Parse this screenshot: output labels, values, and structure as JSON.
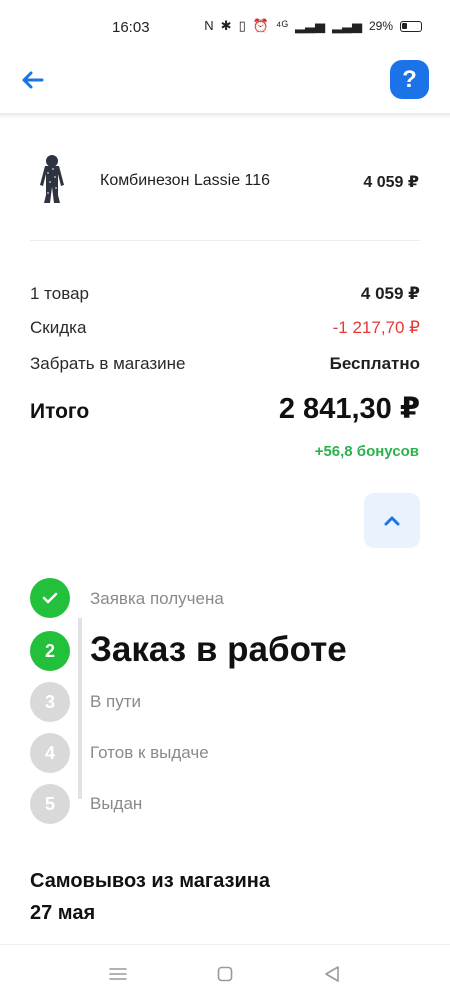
{
  "status_bar": {
    "time": "16:03",
    "network": "⁴ᴳ",
    "battery": "29%"
  },
  "header": {
    "back_icon": "arrow-left-icon",
    "help_label": "?"
  },
  "product": {
    "name": "Комбинезон Lassie 116",
    "price": "4 059 ₽"
  },
  "summary": {
    "items_label": "1 товар",
    "items_value": "4 059 ₽",
    "discount_label": "Скидка",
    "discount_value": "-1 217,70 ₽",
    "delivery_label": "Забрать в магазине",
    "delivery_value": "Бесплатно",
    "total_label": "Итого",
    "total_value": "2 841,30 ₽",
    "bonus": "+56,8 бонусов"
  },
  "colors": {
    "accent": "#1a73e8",
    "success": "#23c03c",
    "discount": "#e53935",
    "bonus": "#2bb24c",
    "pending": "#d9d9d9"
  },
  "steps": [
    {
      "label": "Заявка получена",
      "state": "done",
      "number": "1"
    },
    {
      "label": "Заказ в работе",
      "state": "current",
      "number": "2"
    },
    {
      "label": "В пути",
      "state": "pending",
      "number": "3"
    },
    {
      "label": "Готов к выдаче",
      "state": "pending",
      "number": "4"
    },
    {
      "label": "Выдан",
      "state": "pending",
      "number": "5"
    }
  ],
  "pickup": {
    "title": "Самовывоз из магазина",
    "date": "27 мая"
  }
}
